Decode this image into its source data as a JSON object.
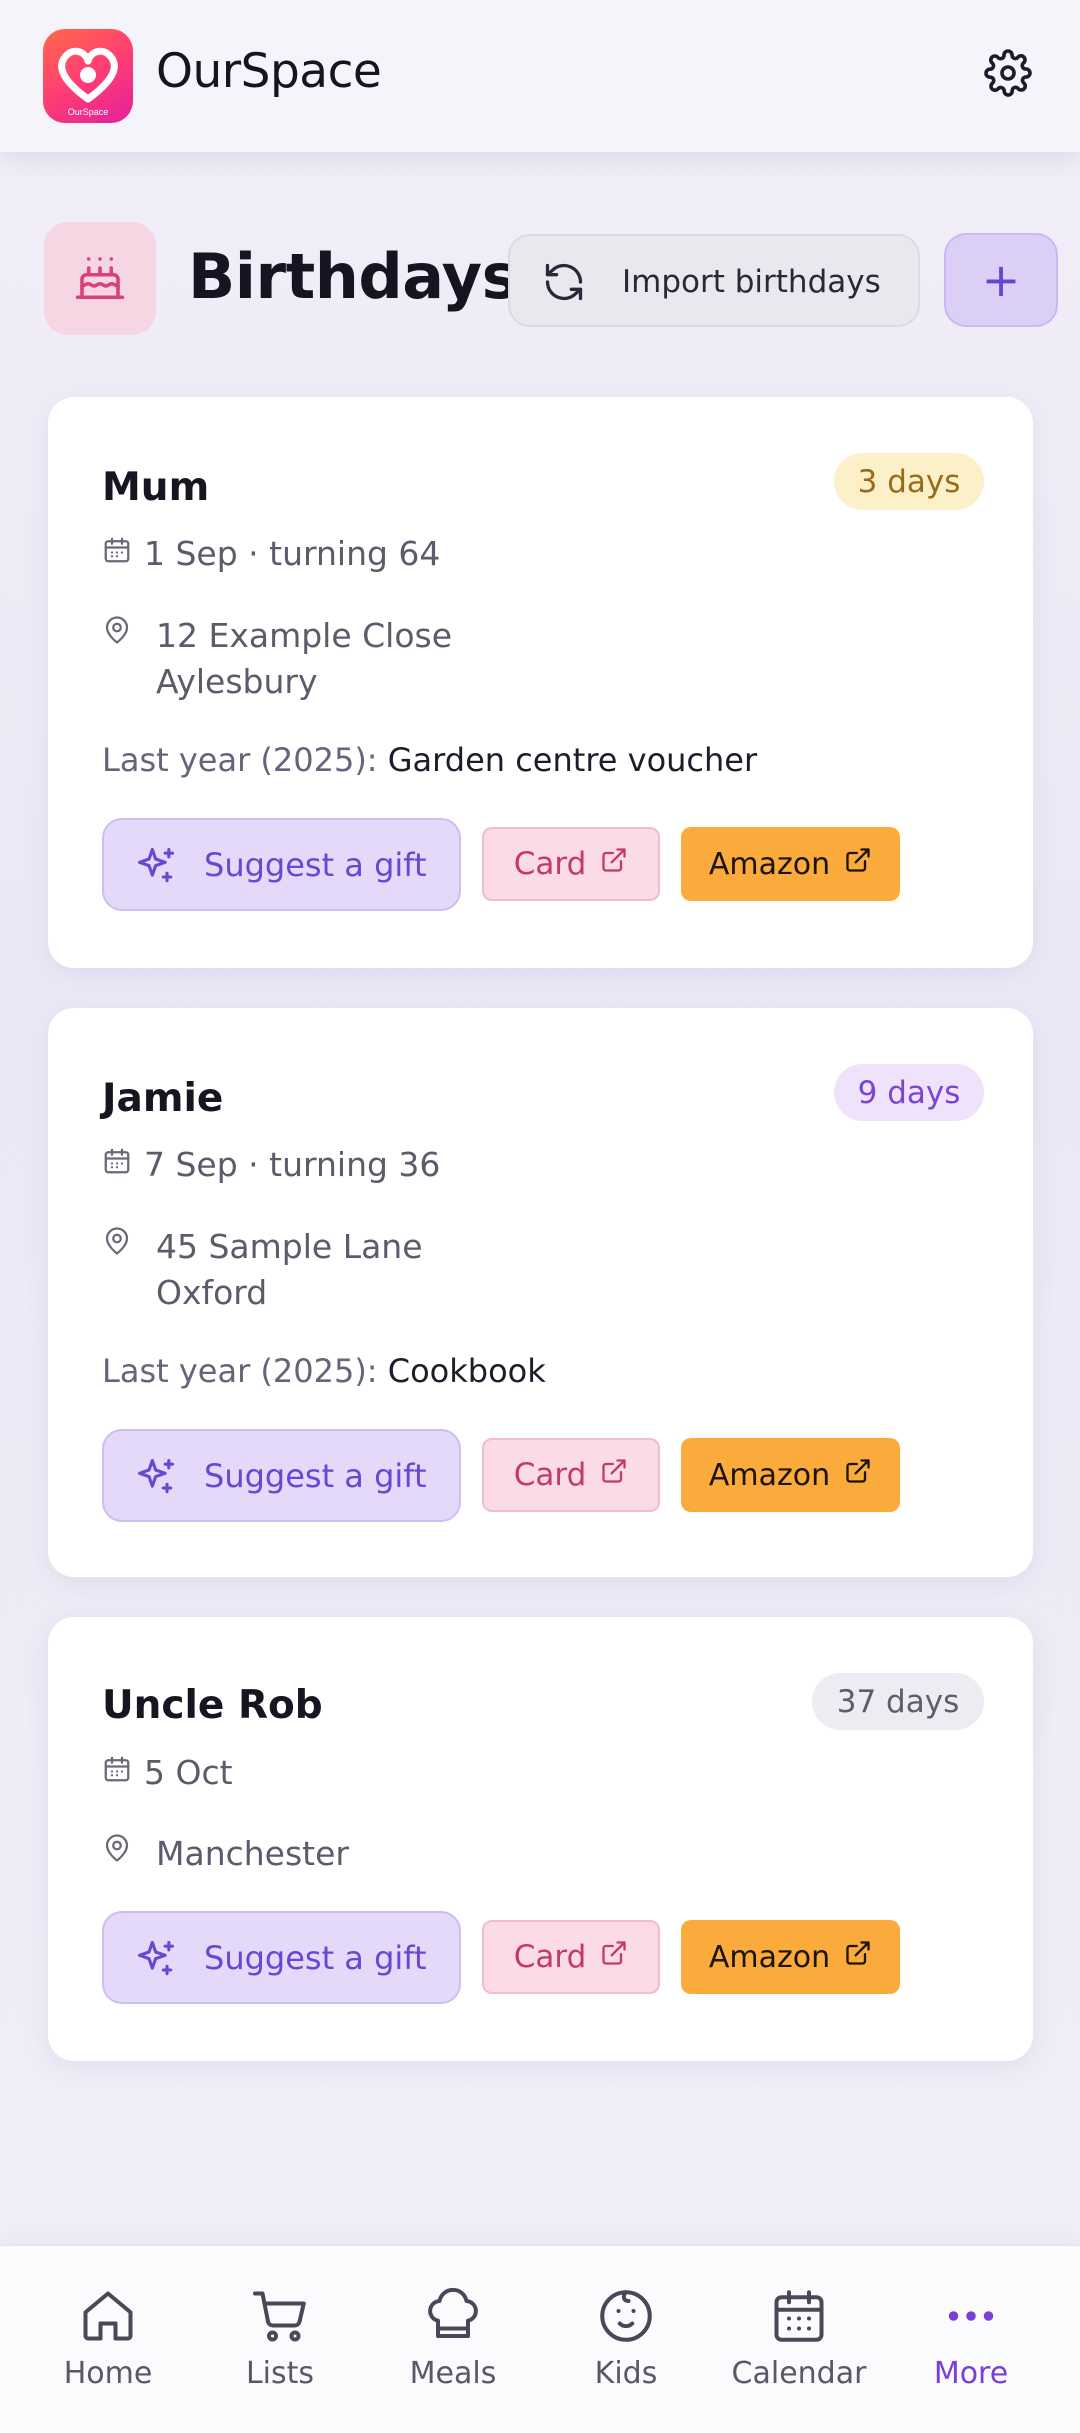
{
  "app": {
    "title": "OurSpace",
    "logo_text": "OurSpace",
    "accent": "#7b3fd6",
    "brand_gradient": [
      "#ff6a4c",
      "#ff3d73",
      "#e4209b"
    ]
  },
  "header": {
    "settings_icon": "gear-icon"
  },
  "page": {
    "title": "Birthdays",
    "title_icon": "cake-icon",
    "import_label": "Import birthdays",
    "import_icon": "refresh-icon",
    "add_label": "+"
  },
  "birthdays": [
    {
      "name": "Mum",
      "days_badge": "3 days",
      "date_text": "1 Sep · turning 64",
      "address_line1": "12 Example Close",
      "address_line2": "Aylesbury",
      "last_year_label": "Last year (2025):",
      "last_year_gift": "Garden centre voucher",
      "suggest_label": "Suggest a gift",
      "card_label": "Card",
      "amazon_label": "Amazon"
    },
    {
      "name": "Jamie",
      "days_badge": "9 days",
      "date_text": "7 Sep · turning 36",
      "address_line1": "45 Sample Lane",
      "address_line2": "Oxford",
      "last_year_label": "Last year (2025):",
      "last_year_gift": "Cookbook",
      "suggest_label": "Suggest a gift",
      "card_label": "Card",
      "amazon_label": "Amazon"
    },
    {
      "name": "Uncle Rob",
      "days_badge": "37 days",
      "date_text": "5 Oct",
      "address_line1": "Manchester",
      "suggest_label": "Suggest a gift",
      "card_label": "Card",
      "amazon_label": "Amazon"
    }
  ],
  "nav": [
    {
      "label": "Home",
      "icon": "home-icon"
    },
    {
      "label": "Lists",
      "icon": "cart-icon"
    },
    {
      "label": "Meals",
      "icon": "chef-hat-icon"
    },
    {
      "label": "Kids",
      "icon": "baby-face-icon"
    },
    {
      "label": "Calendar",
      "icon": "calendar-icon"
    },
    {
      "label": "More",
      "icon": "more-dots-icon",
      "active": true
    }
  ]
}
